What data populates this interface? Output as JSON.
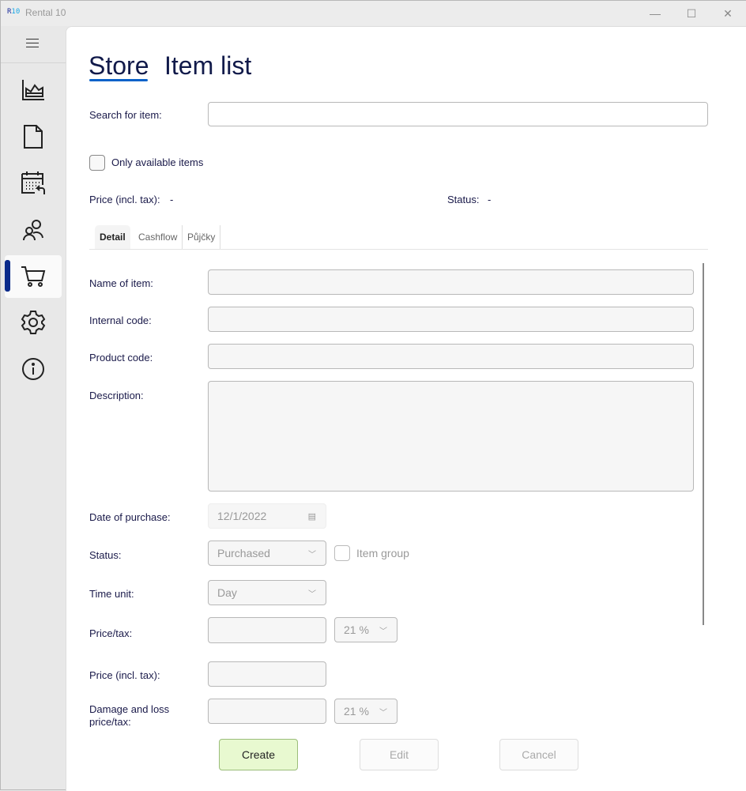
{
  "window": {
    "logo": "R10",
    "title": "Rental 10",
    "minimize": "—",
    "maximize": "☐",
    "close": "✕"
  },
  "sidebar": {
    "items": [
      {
        "name": "dashboard"
      },
      {
        "name": "documents"
      },
      {
        "name": "calendar"
      },
      {
        "name": "customers"
      },
      {
        "name": "store",
        "selected": true
      },
      {
        "name": "settings"
      },
      {
        "name": "about"
      }
    ]
  },
  "header": {
    "title": "Store",
    "subtitle": "Item list"
  },
  "search": {
    "label": "Search for item:",
    "value": ""
  },
  "filter": {
    "only_available_label": "Only available items",
    "checked": false
  },
  "summary": {
    "price_label": "Price (incl. tax):",
    "price_value": "-",
    "status_label": "Status:",
    "status_value": "-"
  },
  "tabs": [
    {
      "label": "Detail",
      "active": true
    },
    {
      "label": "Cashflow"
    },
    {
      "label": "Půjčky"
    }
  ],
  "form": {
    "name_label": "Name of item:",
    "internal_code_label": "Internal code:",
    "product_code_label": "Product code:",
    "description_label": "Description:",
    "date_label": "Date of purchase:",
    "date_value": "12/1/2022",
    "status_label": "Status:",
    "status_value": "Purchased",
    "item_group_label": "Item group",
    "time_unit_label": "Time unit:",
    "time_unit_value": "Day",
    "price_tax_label": "Price/tax:",
    "tax_rate": "21 %",
    "price_incl_label": "Price (incl. tax):",
    "damage_label": "Damage and loss price/tax:",
    "damage_tax_rate": "21 %"
  },
  "buttons": {
    "create": "Create",
    "edit": "Edit",
    "cancel": "Cancel"
  },
  "colors": {
    "accent": "#0a62c9",
    "create_bg": "#e8f9d0",
    "nav_indicator": "#0a2a8a"
  }
}
